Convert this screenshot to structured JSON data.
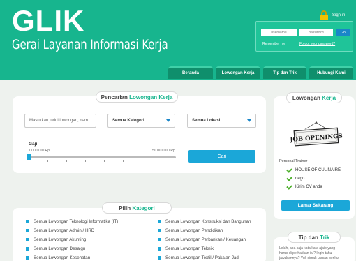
{
  "header": {
    "logo": "GLIK",
    "tagline": "Gerai Layanan Informasi Kerja",
    "sign_in": "Sign in",
    "login": {
      "username_placeholder": "username",
      "password_placeholder": "password",
      "go": "Go",
      "remember": "Remember me",
      "forgot": "Forgot your password?"
    },
    "nav": [
      "Beranda",
      "Lowongan Kerja",
      "Tip dan Trik",
      "Hubungi Kami"
    ]
  },
  "search": {
    "title_plain": "Pencarian",
    "title_accent": "Lowongan Kerja",
    "keyword_placeholder": "Masukkan judul lowongan, nam",
    "category": "Semua Kategori",
    "location": "Semua Lokasi",
    "salary_label": "Gaji",
    "salary_min": "1.000.000 Rp",
    "salary_max": "50.000.000 Rp",
    "salary_level": 0,
    "search_button": "Cari"
  },
  "categories": {
    "title_plain": "Pilih",
    "title_accent": "Kategori",
    "left": [
      "Semua Lowongan Teknologi Informatika (IT)",
      "Semua Lowongan Admin / HRD",
      "Semua Lowongan Akunting",
      "Semua Lowongan Desaign",
      "Semua Lowongan Kesehatan"
    ],
    "right": [
      "Semua Lowongan Konstruksi dan Bangunan",
      "Semua Lowongan Pendidikan",
      "Semua Lowongan Perbankan / Keuangan",
      "Semua Lowongan Teknik",
      "Semua Lowongan Textil / Pakaian Jadi"
    ]
  },
  "sidebar_jobs": {
    "title_plain": "Lowongan",
    "title_accent": "Kerja",
    "sign_text": "JOB OPENINGS",
    "job_title": "Personal Trainer",
    "details": [
      "HOUSE OF CULINAIRE",
      "nego",
      "Kirim CV anda"
    ],
    "apply_button": "Lamar Sekarang"
  },
  "sidebar_tips": {
    "title_plain": "Tip dan",
    "title_accent": "Trik",
    "text_line1": "Lelah, apa saja kata-kata ajaib yang",
    "text_line2": "harus di perhatikan itu? Ingin tahu",
    "text_line3": "jawabannya? Yuk simak ulasan berikut"
  },
  "colors": {
    "brand": "#17b58e",
    "accent_blue": "#1ba7d8",
    "nav_tab": "#0f8f6c"
  }
}
